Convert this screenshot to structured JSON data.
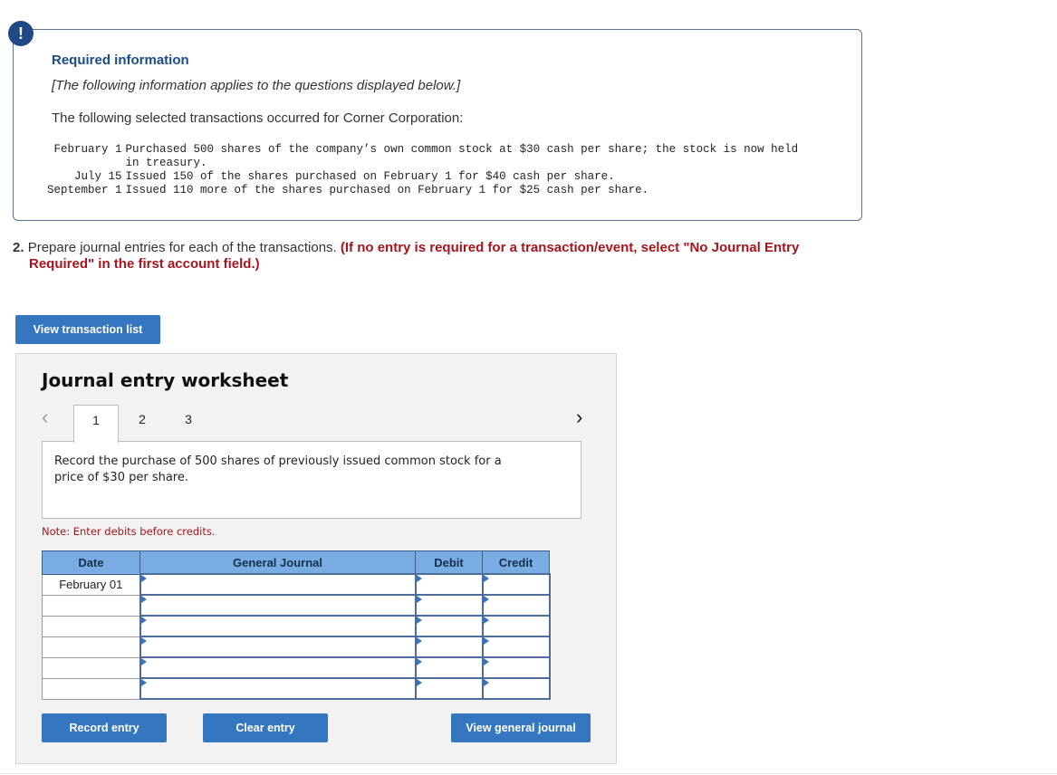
{
  "info": {
    "badge_icon": "exclamation-icon",
    "badge_glyph": "!",
    "title": "Required information",
    "italic_note": "[The following information applies to the questions displayed below.]",
    "intro": "The following selected transactions occurred for Corner Corporation:",
    "transactions": [
      {
        "date": "February 1",
        "description": "Purchased 500 shares of the company’s own common stock at $30 cash per share; the stock is now held in treasury."
      },
      {
        "date": "July 15",
        "description": "Issued 150 of the shares purchased on February 1 for $40 cash per share."
      },
      {
        "date": "September 1",
        "description": "Issued 110 more of the shares purchased on February 1 for $25 cash per share."
      }
    ]
  },
  "question": {
    "number": "2.",
    "text": "Prepare journal entries for each of the transactions.",
    "instruction_line1": "(If no entry is required for a transaction/event, select \"No Journal Entry",
    "instruction_line2": "Required\" in the first account field.)"
  },
  "buttons": {
    "view_transaction_list": "View transaction list",
    "record_entry": "Record entry",
    "clear_entry": "Clear entry",
    "view_general_journal": "View general journal"
  },
  "worksheet": {
    "title": "Journal entry worksheet",
    "prev_icon": "chevron-left-icon",
    "prev_glyph": "‹",
    "next_icon": "chevron-right-icon",
    "next_glyph": "›",
    "tabs": [
      {
        "label": "1",
        "active": true
      },
      {
        "label": "2",
        "active": false
      },
      {
        "label": "3",
        "active": false
      }
    ],
    "description": "Record the purchase of 500 shares of previously issued common stock for a price of $30 per share.",
    "note": "Note: Enter debits before credits.",
    "table": {
      "headers": [
        "Date",
        "General Journal",
        "Debit",
        "Credit"
      ],
      "rows": [
        {
          "date": "February 01",
          "account": "",
          "debit": "",
          "credit": ""
        },
        {
          "date": "",
          "account": "",
          "debit": "",
          "credit": ""
        },
        {
          "date": "",
          "account": "",
          "debit": "",
          "credit": ""
        },
        {
          "date": "",
          "account": "",
          "debit": "",
          "credit": ""
        },
        {
          "date": "",
          "account": "",
          "debit": "",
          "credit": ""
        },
        {
          "date": "",
          "account": "",
          "debit": "",
          "credit": ""
        }
      ]
    }
  },
  "colors": {
    "brand_blue": "#3576c0",
    "header_blue": "#79ace2",
    "title_navy": "#1c4c85",
    "alert_red": "#a7151d"
  }
}
